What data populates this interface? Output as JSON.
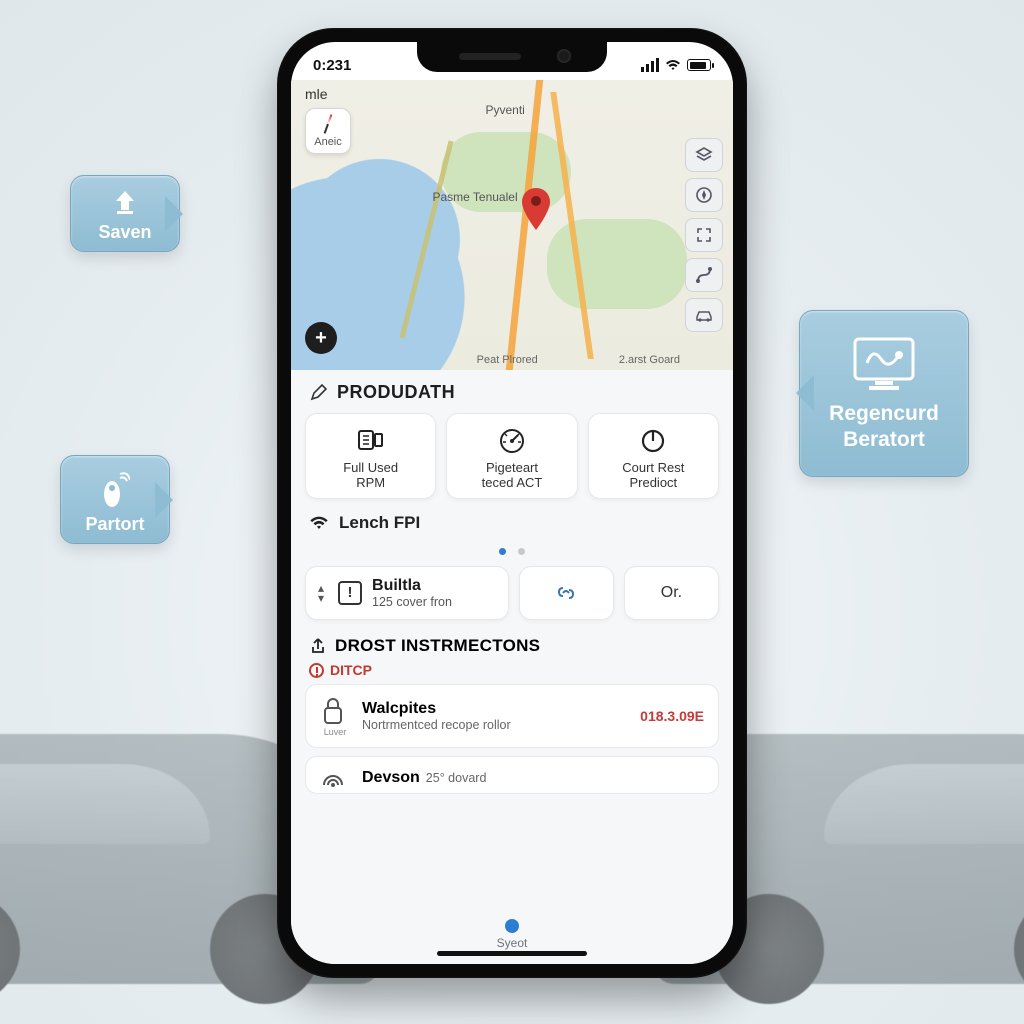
{
  "statusbar": {
    "time": "0:231"
  },
  "app": {
    "header_prefix": "mle",
    "compass_label": "Aneic"
  },
  "map": {
    "add_label": "+",
    "bottom_labels": {
      "a": "Peat  Plrored",
      "b": "2.arst  Goard"
    },
    "city_labels": {
      "top": "Pyventi",
      "mid": "Pasme Tenualel"
    }
  },
  "tools": {
    "a": "layers",
    "b": "compass",
    "c": "fullscreen",
    "d": "route",
    "e": "car"
  },
  "section_produdath": {
    "title": "PRODUDATH"
  },
  "cards": [
    {
      "line1": "Full Used",
      "line2": "RPM"
    },
    {
      "line1": "Pigeteart",
      "line2": "teced ACT"
    },
    {
      "line1": "Court Rest",
      "line2": "Predioct"
    }
  ],
  "wifi_section": {
    "title": "Lench FPI"
  },
  "bultla": {
    "title": "Builtla",
    "sub": "125 cover fron",
    "or": "Or."
  },
  "section_instr": {
    "title": "DROST INSTRMECTONS"
  },
  "dtcp_label": "DITCP",
  "list": [
    {
      "title": "Walcpites",
      "sub": "Nortrmentced recope rollor",
      "value": "018.3.09E",
      "icon_sub": "Luver"
    },
    {
      "title": "Devson",
      "sub": "25° dovard",
      "value": "",
      "icon_sub": ""
    }
  ],
  "bottombar": {
    "label": "Syeot"
  },
  "callouts": {
    "saven": {
      "label": "Saven"
    },
    "partort": {
      "label": "Partort"
    },
    "regen": {
      "line1": "Regencurd",
      "line2": "Beratort"
    }
  }
}
